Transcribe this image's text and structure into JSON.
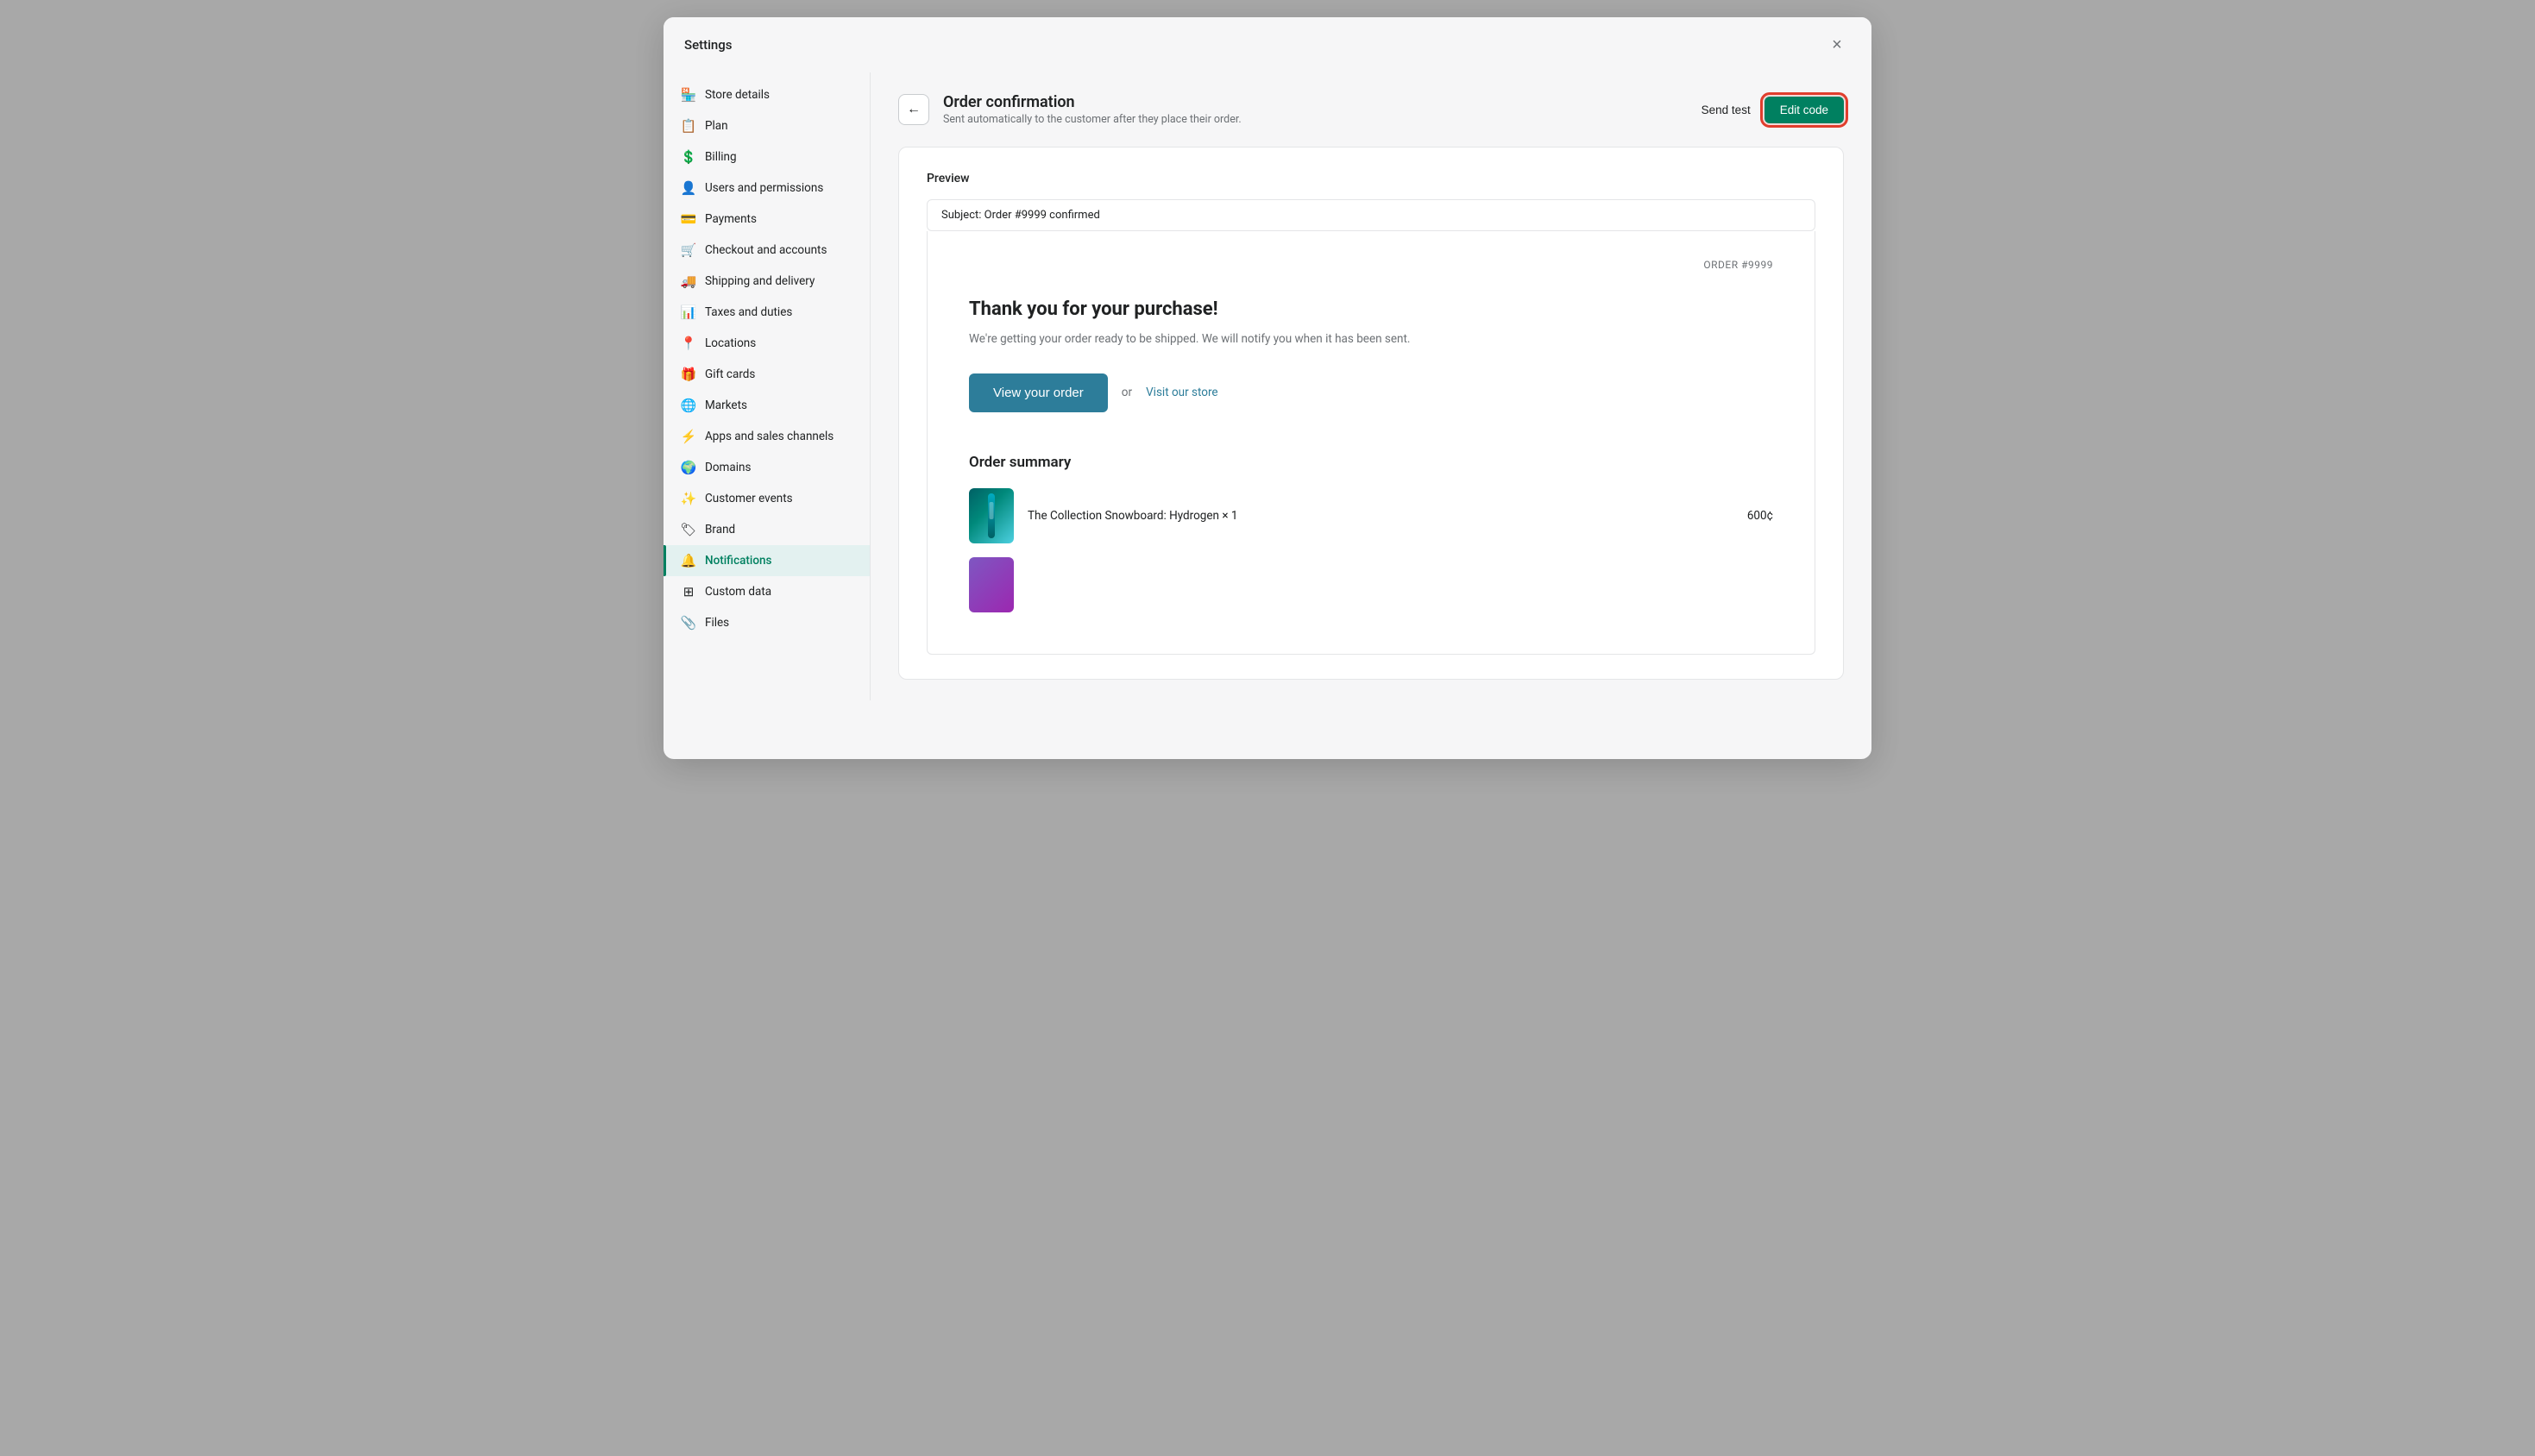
{
  "modal": {
    "title": "Settings",
    "close_label": "×"
  },
  "sidebar": {
    "items": [
      {
        "id": "store-details",
        "label": "Store details",
        "icon": "🏪",
        "active": false
      },
      {
        "id": "plan",
        "label": "Plan",
        "icon": "📋",
        "active": false
      },
      {
        "id": "billing",
        "label": "Billing",
        "icon": "💲",
        "active": false
      },
      {
        "id": "users-permissions",
        "label": "Users and permissions",
        "icon": "👤",
        "active": false
      },
      {
        "id": "payments",
        "label": "Payments",
        "icon": "💳",
        "active": false
      },
      {
        "id": "checkout-accounts",
        "label": "Checkout and accounts",
        "icon": "🛒",
        "active": false
      },
      {
        "id": "shipping-delivery",
        "label": "Shipping and delivery",
        "icon": "🚚",
        "active": false
      },
      {
        "id": "taxes-duties",
        "label": "Taxes and duties",
        "icon": "📊",
        "active": false
      },
      {
        "id": "locations",
        "label": "Locations",
        "icon": "📍",
        "active": false
      },
      {
        "id": "gift-cards",
        "label": "Gift cards",
        "icon": "🎁",
        "active": false
      },
      {
        "id": "markets",
        "label": "Markets",
        "icon": "🌐",
        "active": false
      },
      {
        "id": "apps-sales-channels",
        "label": "Apps and sales channels",
        "icon": "⚡",
        "active": false
      },
      {
        "id": "domains",
        "label": "Domains",
        "icon": "🌍",
        "active": false
      },
      {
        "id": "customer-events",
        "label": "Customer events",
        "icon": "✨",
        "active": false
      },
      {
        "id": "brand",
        "label": "Brand",
        "icon": "🏷",
        "active": false
      },
      {
        "id": "notifications",
        "label": "Notifications",
        "icon": "🔔",
        "active": true
      },
      {
        "id": "custom-data",
        "label": "Custom data",
        "icon": "⊞",
        "active": false
      },
      {
        "id": "files",
        "label": "Files",
        "icon": "📎",
        "active": false
      }
    ]
  },
  "topbar": {
    "back_button_label": "←",
    "title": "Order confirmation",
    "subtitle": "Sent automatically to the customer after they place their order.",
    "send_test_label": "Send test",
    "edit_code_label": "Edit code"
  },
  "preview": {
    "section_label": "Preview",
    "subject_prefix": "Subject:",
    "subject_text": "Order #9999 confirmed",
    "order_number_label": "ORDER #9999",
    "thank_you_heading": "Thank you for your purchase!",
    "description": "We're getting your order ready to be shipped. We will notify you when it has been sent.",
    "view_order_button": "View your order",
    "or_text": "or",
    "visit_store_text": "Visit our store",
    "order_summary_title": "Order summary",
    "items": [
      {
        "name": "The Collection Snowboard: Hydrogen × 1",
        "price": "600¢",
        "color": "teal"
      },
      {
        "name": "",
        "price": "",
        "color": "purple"
      }
    ]
  }
}
